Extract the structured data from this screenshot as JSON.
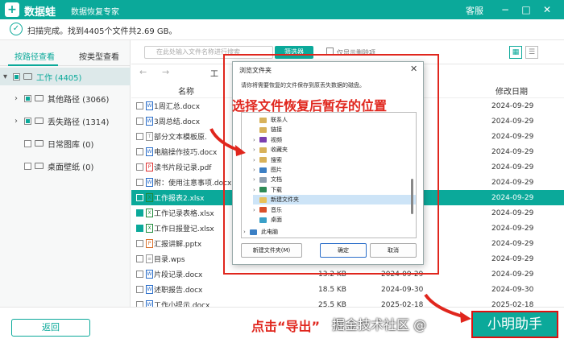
{
  "titlebar": {
    "logo_char": "+",
    "app_name": "数据蛙",
    "subtitle": "数据恢复专家",
    "service": "客服",
    "min": "−",
    "max": "□",
    "close": "✕"
  },
  "status": {
    "check": "✓",
    "text": "扫描完成。找到4405个文件共2.69 GB。"
  },
  "left": {
    "tabs": [
      "按路径查看",
      "按类型查看"
    ],
    "tree": [
      {
        "arrow": "▾",
        "label": "工作 (4405)"
      },
      {
        "arrow": "›",
        "label": "其他路径 (3066)"
      },
      {
        "arrow": "›",
        "label": "丢失路径 (1314)"
      },
      {
        "arrow": "",
        "label": "日常图库 (0)"
      },
      {
        "arrow": "",
        "label": "桌面壁纸 (0)"
      }
    ]
  },
  "toolbar": {
    "search_placeholder": "在此处输入文件名称进行搜索",
    "filter": "筛选器",
    "show_deleted": "仅显示删除项",
    "view1": "▦",
    "view2": "☰"
  },
  "nav": {
    "back": "←",
    "forward": "→",
    "path": "工"
  },
  "table": {
    "headers": {
      "name": "名称",
      "modified": "修改日期"
    },
    "rows": [
      {
        "icon": "W",
        "type": "doc",
        "name": "1周汇总.docx",
        "size": "",
        "fdate": "",
        "mdate": "2024-09-29"
      },
      {
        "icon": "W",
        "type": "doc",
        "name": "3周总结.docx",
        "size": "",
        "fdate": "",
        "mdate": "2024-09-29"
      },
      {
        "icon": "T",
        "type": "txt",
        "name": "部分文本模板原.",
        "size": "",
        "fdate": "",
        "mdate": "2024-09-29"
      },
      {
        "icon": "W",
        "type": "doc",
        "name": "电脑操作技巧.docx",
        "size": "",
        "fdate": "",
        "mdate": "2024-09-29"
      },
      {
        "icon": "P",
        "type": "pdf",
        "name": "读书片段记录.pdf",
        "size": "",
        "fdate": "",
        "mdate": "2024-09-29"
      },
      {
        "icon": "W",
        "type": "doc",
        "name": "附：使用注意事项.docx",
        "size": "",
        "fdate": "",
        "mdate": "2024-09-29"
      },
      {
        "icon": "X",
        "type": "xls",
        "name": "工作报表2.xlsx",
        "size": "",
        "fdate": "",
        "mdate": "2024-09-29"
      },
      {
        "icon": "X",
        "type": "xls",
        "name": "工作记录表格.xlsx",
        "size": "",
        "fdate": "",
        "mdate": "2024-09-29"
      },
      {
        "icon": "X",
        "type": "xls",
        "name": "工作日报登记.xlsx",
        "size": "",
        "fdate": "",
        "mdate": "2024-09-29"
      },
      {
        "icon": "P",
        "type": "ppt",
        "name": "汇报讲解.pptx",
        "size": "",
        "fdate": "",
        "mdate": "2024-09-29"
      },
      {
        "icon": "≡",
        "type": "wps",
        "name": "目录.wps",
        "size": "",
        "fdate": "",
        "mdate": "2024-09-29"
      },
      {
        "icon": "W",
        "type": "doc",
        "name": "片段记录.docx",
        "size": "13.2 KB",
        "fdate": "2024-09-29",
        "mdate": "2024-09-29"
      },
      {
        "icon": "W",
        "type": "doc",
        "name": "述职报告.docx",
        "size": "18.5 KB",
        "fdate": "2024-09-30",
        "mdate": "2024-09-30"
      },
      {
        "icon": "W",
        "type": "doc",
        "name": "工作小提示.docx",
        "size": "25.5 KB",
        "fdate": "2025-02-18",
        "mdate": "2025-02-18"
      }
    ]
  },
  "dialog": {
    "title": "浏览文件夹",
    "close": "✕",
    "description": "请你将需要恢复的文件保存到原丢失数据的磁盘。",
    "annotation": "选择文件恢复后暂存的位置",
    "tree": [
      {
        "chev": "",
        "label": "联系人",
        "color": "#d8b25a"
      },
      {
        "chev": "",
        "label": "链接",
        "color": "#d8b25a"
      },
      {
        "chev": "›",
        "label": "视频",
        "color": "#7b3fb0"
      },
      {
        "chev": "›",
        "label": "收藏夹",
        "color": "#d8b25a"
      },
      {
        "chev": "›",
        "label": "搜索",
        "color": "#d8b25a"
      },
      {
        "chev": "›",
        "label": "图片",
        "color": "#3b7fc4"
      },
      {
        "chev": "›",
        "label": "文档",
        "color": "#8fa0b0"
      },
      {
        "chev": "›",
        "label": "下载",
        "color": "#2e8b57"
      },
      {
        "chev": "",
        "label": "新建文件夹",
        "color": "#e8c25a"
      },
      {
        "chev": "›",
        "label": "音乐",
        "color": "#d9502b"
      },
      {
        "chev": "",
        "label": "桌面",
        "color": "#3aa0c8"
      },
      {
        "chev": "›",
        "label": "此电脑",
        "color": "#3b7fc4"
      }
    ],
    "new_folder": "新建文件夹(M)",
    "ok": "确定",
    "cancel": "取消"
  },
  "bottom": {
    "back": "返回",
    "callout": "点击“导出”",
    "watermark": "掘金技术社区 @",
    "export": "小明助手"
  },
  "colors": {
    "brand": "#0ba99a",
    "annotation": "#e0261d"
  }
}
